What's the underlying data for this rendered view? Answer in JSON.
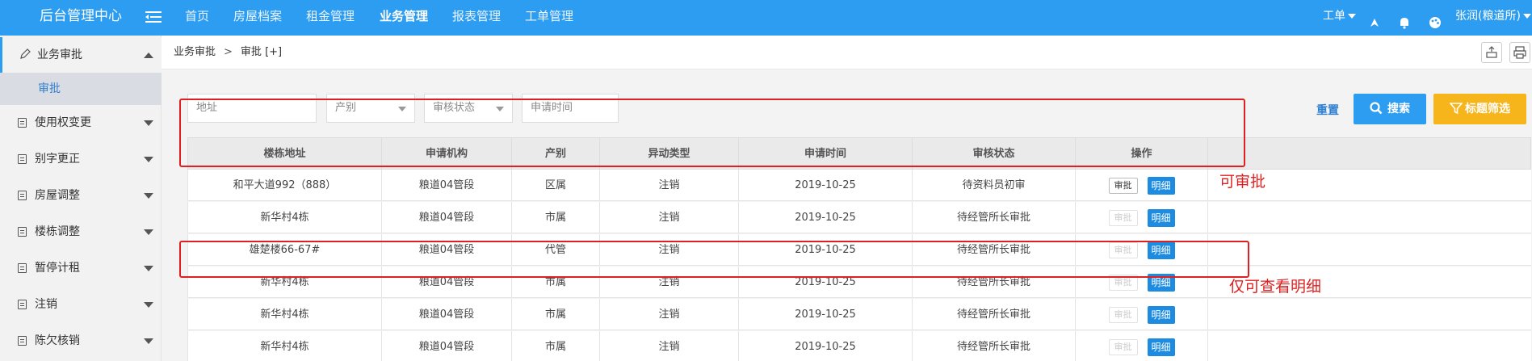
{
  "header": {
    "brand": "后台管理中心",
    "nav": [
      "首页",
      "房屋档案",
      "租金管理",
      "业务管理",
      "报表管理",
      "工单管理"
    ],
    "active_nav": "业务管理",
    "workorder_label": "工单",
    "user": "张润(粮道所)"
  },
  "sidebar": {
    "open_item": "业务审批",
    "sub_item": "审批",
    "items": [
      "使用权变更",
      "别字更正",
      "房屋调整",
      "楼栋调整",
      "暂停计租",
      "注销",
      "陈欠核销"
    ]
  },
  "breadcrumb": {
    "root": "业务审批",
    "separator": ">",
    "current": "审批",
    "extra": "[+]"
  },
  "filters": {
    "address_placeholder": "地址",
    "property_placeholder": "产别",
    "status_placeholder": "审核状态",
    "date_placeholder": "申请时间",
    "reset_label": "重置",
    "search_label": "搜索",
    "filter_label": "标题筛选"
  },
  "table": {
    "columns": [
      "楼栋地址",
      "申请机构",
      "产别",
      "异动类型",
      "申请时间",
      "审核状态",
      "操作"
    ],
    "approve_label": "审批",
    "detail_label": "明细",
    "rows": [
      {
        "address": "和平大道992（888）",
        "org": "粮道04管段",
        "type": "区属",
        "change": "注销",
        "date": "2019-10-25",
        "status": "待资料员初审",
        "approve_enabled": true
      },
      {
        "address": "新华村4栋",
        "org": "粮道04管段",
        "type": "市属",
        "change": "注销",
        "date": "2019-10-25",
        "status": "待经管所长审批",
        "approve_enabled": false
      },
      {
        "address": "雄楚楼66-67#",
        "org": "粮道04管段",
        "type": "代管",
        "change": "注销",
        "date": "2019-10-25",
        "status": "待经管所长审批",
        "approve_enabled": false
      },
      {
        "address": "新华村4栋",
        "org": "粮道04管段",
        "type": "市属",
        "change": "注销",
        "date": "2019-10-25",
        "status": "待经管所长审批",
        "approve_enabled": false
      },
      {
        "address": "新华村4栋",
        "org": "粮道04管段",
        "type": "市属",
        "change": "注销",
        "date": "2019-10-25",
        "status": "待经管所长审批",
        "approve_enabled": false
      },
      {
        "address": "新华村4栋",
        "org": "粮道04管段",
        "type": "市属",
        "change": "注销",
        "date": "2019-10-25",
        "status": "待经管所长审批",
        "approve_enabled": false
      }
    ]
  },
  "annotations": {
    "can_approve": "可审批",
    "detail_only": "仅可查看明细"
  },
  "colors": {
    "header_bg": "#2d9df1",
    "search_btn": "#2d9df1",
    "filter_btn": "#f7b51c",
    "detail_btn": "#1d8ce0",
    "annotation": "#e02020"
  }
}
